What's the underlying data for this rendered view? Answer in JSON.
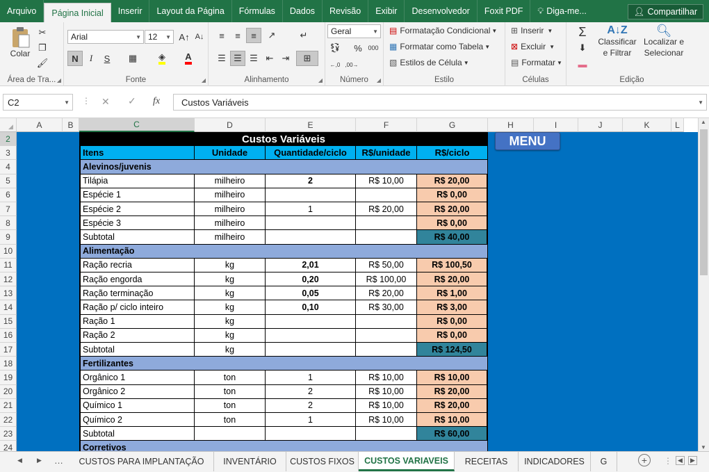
{
  "ribbon_tabs": [
    "Arquivo",
    "Página Inicial",
    "Inserir",
    "Layout da Página",
    "Fórmulas",
    "Dados",
    "Revisão",
    "Exibir",
    "Desenvolvedor",
    "Foxit PDF"
  ],
  "tell_me": "Diga-me...",
  "share_label": "Compartilhar",
  "clipboard": {
    "paste": "Colar",
    "group": "Área de Tra..."
  },
  "font": {
    "name": "Arial",
    "size": "12",
    "bold": "N",
    "italic": "I",
    "underline": "S",
    "group": "Fonte"
  },
  "alignment": {
    "group": "Alinhamento"
  },
  "number": {
    "format": "Geral",
    "percent": "%",
    "thousands": "000",
    "group": "Número"
  },
  "styles": {
    "conditional": "Formatação Condicional",
    "table": "Formatar como Tabela",
    "cell_styles": "Estilos de Célula",
    "group": "Estilo"
  },
  "cells": {
    "insert": "Inserir",
    "delete": "Excluir",
    "format": "Formatar",
    "group": "Células"
  },
  "editing": {
    "sum": "Σ",
    "sort1": "Classificar",
    "sort2": "e Filtrar",
    "find1": "Localizar e",
    "find2": "Selecionar",
    "group": "Edição"
  },
  "formula_bar": {
    "name_box": "C2",
    "fx": "fx",
    "formula": "Custos Variáveis"
  },
  "columns": [
    "A",
    "B",
    "C",
    "D",
    "E",
    "F",
    "G",
    "H",
    "I",
    "J",
    "K",
    "L"
  ],
  "rows": [
    "2",
    "3",
    "4",
    "5",
    "6",
    "7",
    "8",
    "9",
    "10",
    "11",
    "12",
    "13",
    "14",
    "15",
    "16",
    "17",
    "18",
    "19",
    "20",
    "21",
    "22",
    "23",
    "24"
  ],
  "menu_button": "MENU",
  "sheet": {
    "title": "Custos Variáveis",
    "headers": [
      "Itens",
      "Unidade",
      "Quantidade/ciclo",
      "R$/unidade",
      "R$/ciclo"
    ],
    "rows": [
      {
        "type": "section",
        "item": "Alevinos/juvenis"
      },
      {
        "type": "data",
        "item": "Tilápia",
        "unit": "milheiro",
        "qty": "2",
        "qty_bold": true,
        "price": "R$ 10,00",
        "total": "R$ 20,00"
      },
      {
        "type": "data",
        "item": "Espécie 1",
        "unit": "milheiro",
        "qty": "",
        "price": "",
        "total": "R$ 0,00"
      },
      {
        "type": "data",
        "item": "Espécie 2",
        "unit": "milheiro",
        "qty": "1",
        "qty_bold": false,
        "price": "R$ 20,00",
        "total": "R$ 20,00"
      },
      {
        "type": "data",
        "item": "Espécie 3",
        "unit": "milheiro",
        "qty": "",
        "price": "",
        "total": "R$ 0,00"
      },
      {
        "type": "subtotal",
        "item": "Subtotal",
        "unit": "milheiro",
        "qty": "",
        "price": "",
        "total": "R$ 40,00"
      },
      {
        "type": "section",
        "item": "Alimentação"
      },
      {
        "type": "data",
        "item": "Ração recria",
        "unit": "kg",
        "qty": "2,01",
        "qty_bold": true,
        "price": "R$ 50,00",
        "total": "R$ 100,50"
      },
      {
        "type": "data",
        "item": "Ração engorda",
        "unit": "kg",
        "qty": "0,20",
        "qty_bold": true,
        "price": "R$ 100,00",
        "total": "R$ 20,00"
      },
      {
        "type": "data",
        "item": "Ração terminação",
        "unit": "kg",
        "qty": "0,05",
        "qty_bold": true,
        "price": "R$ 20,00",
        "total": "R$ 1,00"
      },
      {
        "type": "data",
        "item": "Ração p/ ciclo inteiro",
        "unit": "kg",
        "qty": "0,10",
        "qty_bold": true,
        "price": "R$ 30,00",
        "total": "R$ 3,00"
      },
      {
        "type": "data",
        "item": "Ração 1",
        "unit": "kg",
        "qty": "",
        "price": "",
        "total": "R$ 0,00"
      },
      {
        "type": "data",
        "item": "Ração 2",
        "unit": "kg",
        "qty": "",
        "price": "",
        "total": "R$ 0,00"
      },
      {
        "type": "subtotal",
        "item": "Subtotal",
        "unit": "kg",
        "qty": "",
        "price": "",
        "total": "R$ 124,50"
      },
      {
        "type": "section",
        "item": "Fertilizantes"
      },
      {
        "type": "data",
        "item": "Orgânico 1",
        "unit": "ton",
        "qty": "1",
        "qty_bold": false,
        "price": "R$ 10,00",
        "total": "R$ 10,00"
      },
      {
        "type": "data",
        "item": "Orgânico 2",
        "unit": "ton",
        "qty": "2",
        "qty_bold": false,
        "price": "R$ 10,00",
        "total": "R$ 20,00"
      },
      {
        "type": "data",
        "item": "Químico 1",
        "unit": "ton",
        "qty": "2",
        "qty_bold": false,
        "price": "R$ 10,00",
        "total": "R$ 20,00"
      },
      {
        "type": "data",
        "item": "Químico 2",
        "unit": "ton",
        "qty": "1",
        "qty_bold": false,
        "price": "R$ 10,00",
        "total": "R$ 10,00"
      },
      {
        "type": "subtotal",
        "item": "Subtotal",
        "unit": "",
        "qty": "",
        "price": "",
        "total": "R$ 60,00"
      },
      {
        "type": "section",
        "item": "Corretivos"
      }
    ]
  },
  "sheet_tabs": [
    "CUSTOS PARA IMPLANTAÇÃO",
    "INVENTÁRIO",
    "CUSTOS FIXOS",
    "CUSTOS VARIAVEIS",
    "RECEITAS",
    "INDICADORES",
    "G"
  ],
  "active_sheet": "CUSTOS VARIAVEIS",
  "colors": {
    "excel_green": "#217346",
    "blue_bg": "#0070c0",
    "header_blue": "#00b0f0",
    "section_blue": "#8eaadb",
    "total_orange": "#f8cbad",
    "subtotal_teal": "#31849b",
    "menu_blue": "#4472c4"
  }
}
